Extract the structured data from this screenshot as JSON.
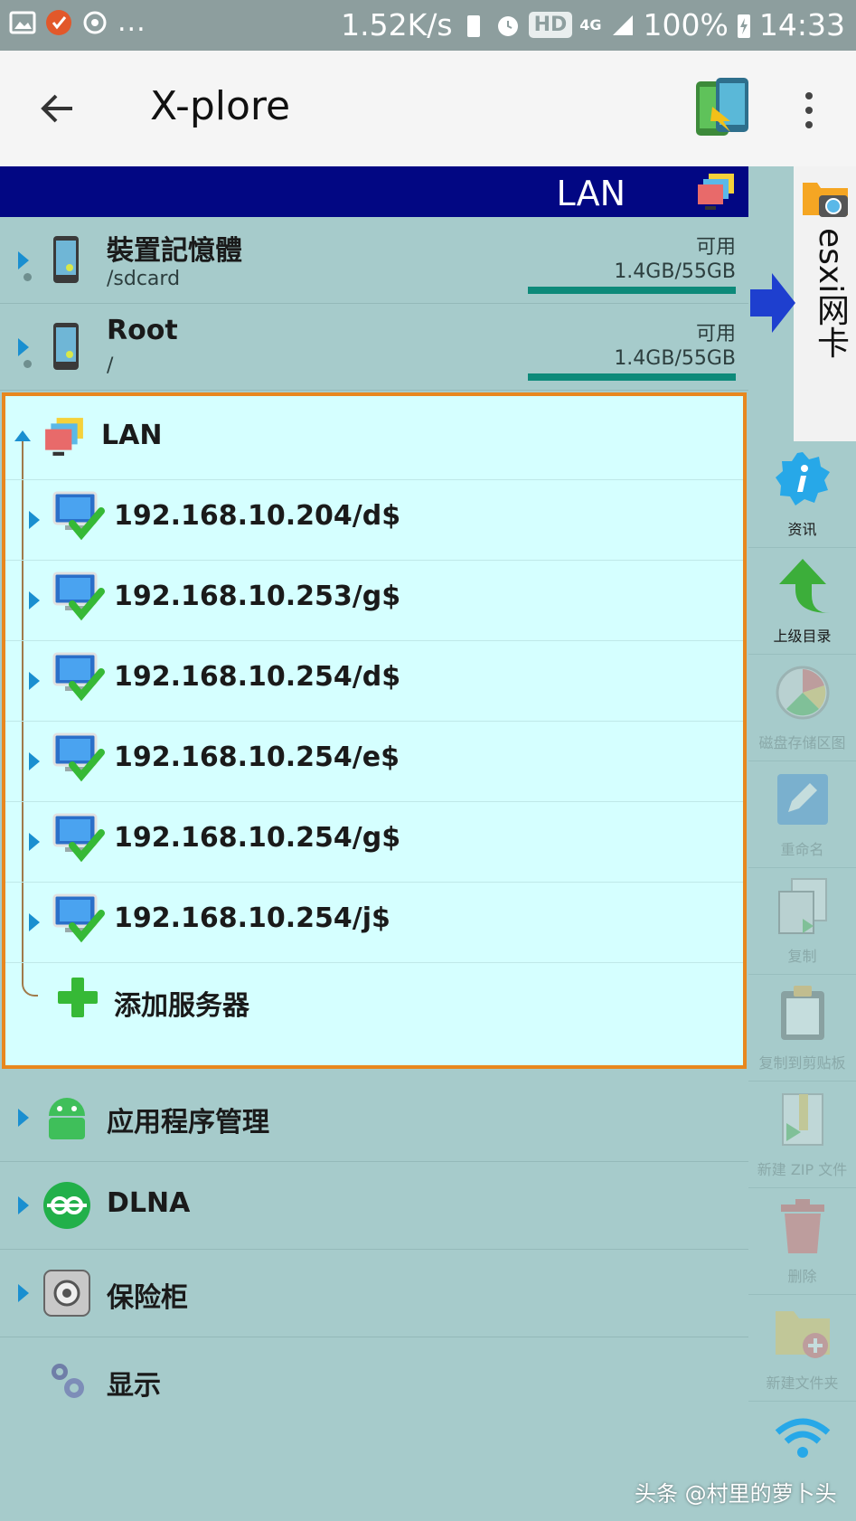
{
  "status_bar": {
    "speed": "1.52K/s",
    "hd": "HD",
    "network": "4G",
    "battery": "100%",
    "time": "14:33",
    "dots": "..."
  },
  "app_bar": {
    "title": "X-plore"
  },
  "panel": {
    "header_label": "LAN",
    "storage": [
      {
        "name": "裝置記憶體",
        "path": "/sdcard",
        "avail_label": "可用",
        "avail_value": "1.4GB/55GB"
      },
      {
        "name": "Root",
        "path": "/",
        "avail_label": "可用",
        "avail_value": "1.4GB/55GB"
      }
    ],
    "lan": {
      "title": "LAN",
      "servers": [
        "192.168.10.204/d$",
        "192.168.10.253/g$",
        "192.168.10.254/d$",
        "192.168.10.254/e$",
        "192.168.10.254/g$",
        "192.168.10.254/j$"
      ],
      "add_server": "添加服务器"
    },
    "other": [
      "应用程序管理",
      "DLNA",
      "保险柜",
      "显示"
    ]
  },
  "right_tab": {
    "label": "esxi网卡"
  },
  "toolbar": {
    "info": "资讯",
    "parent": "上级目录",
    "disk_map": "磁盘存储区图",
    "rename": "重命名",
    "copy": "复制",
    "copy_clipboard": "复制到剪贴板",
    "new_zip": "新建 ZIP 文件",
    "delete": "删除",
    "new_folder": "新建文件夹"
  },
  "watermark": "头条 @村里的萝卜头",
  "colors": {
    "panel_header": "#020783",
    "lan_highlight": "#d5ffff",
    "lan_border": "#e8871e",
    "storage_bar": "#0d8a7a"
  }
}
